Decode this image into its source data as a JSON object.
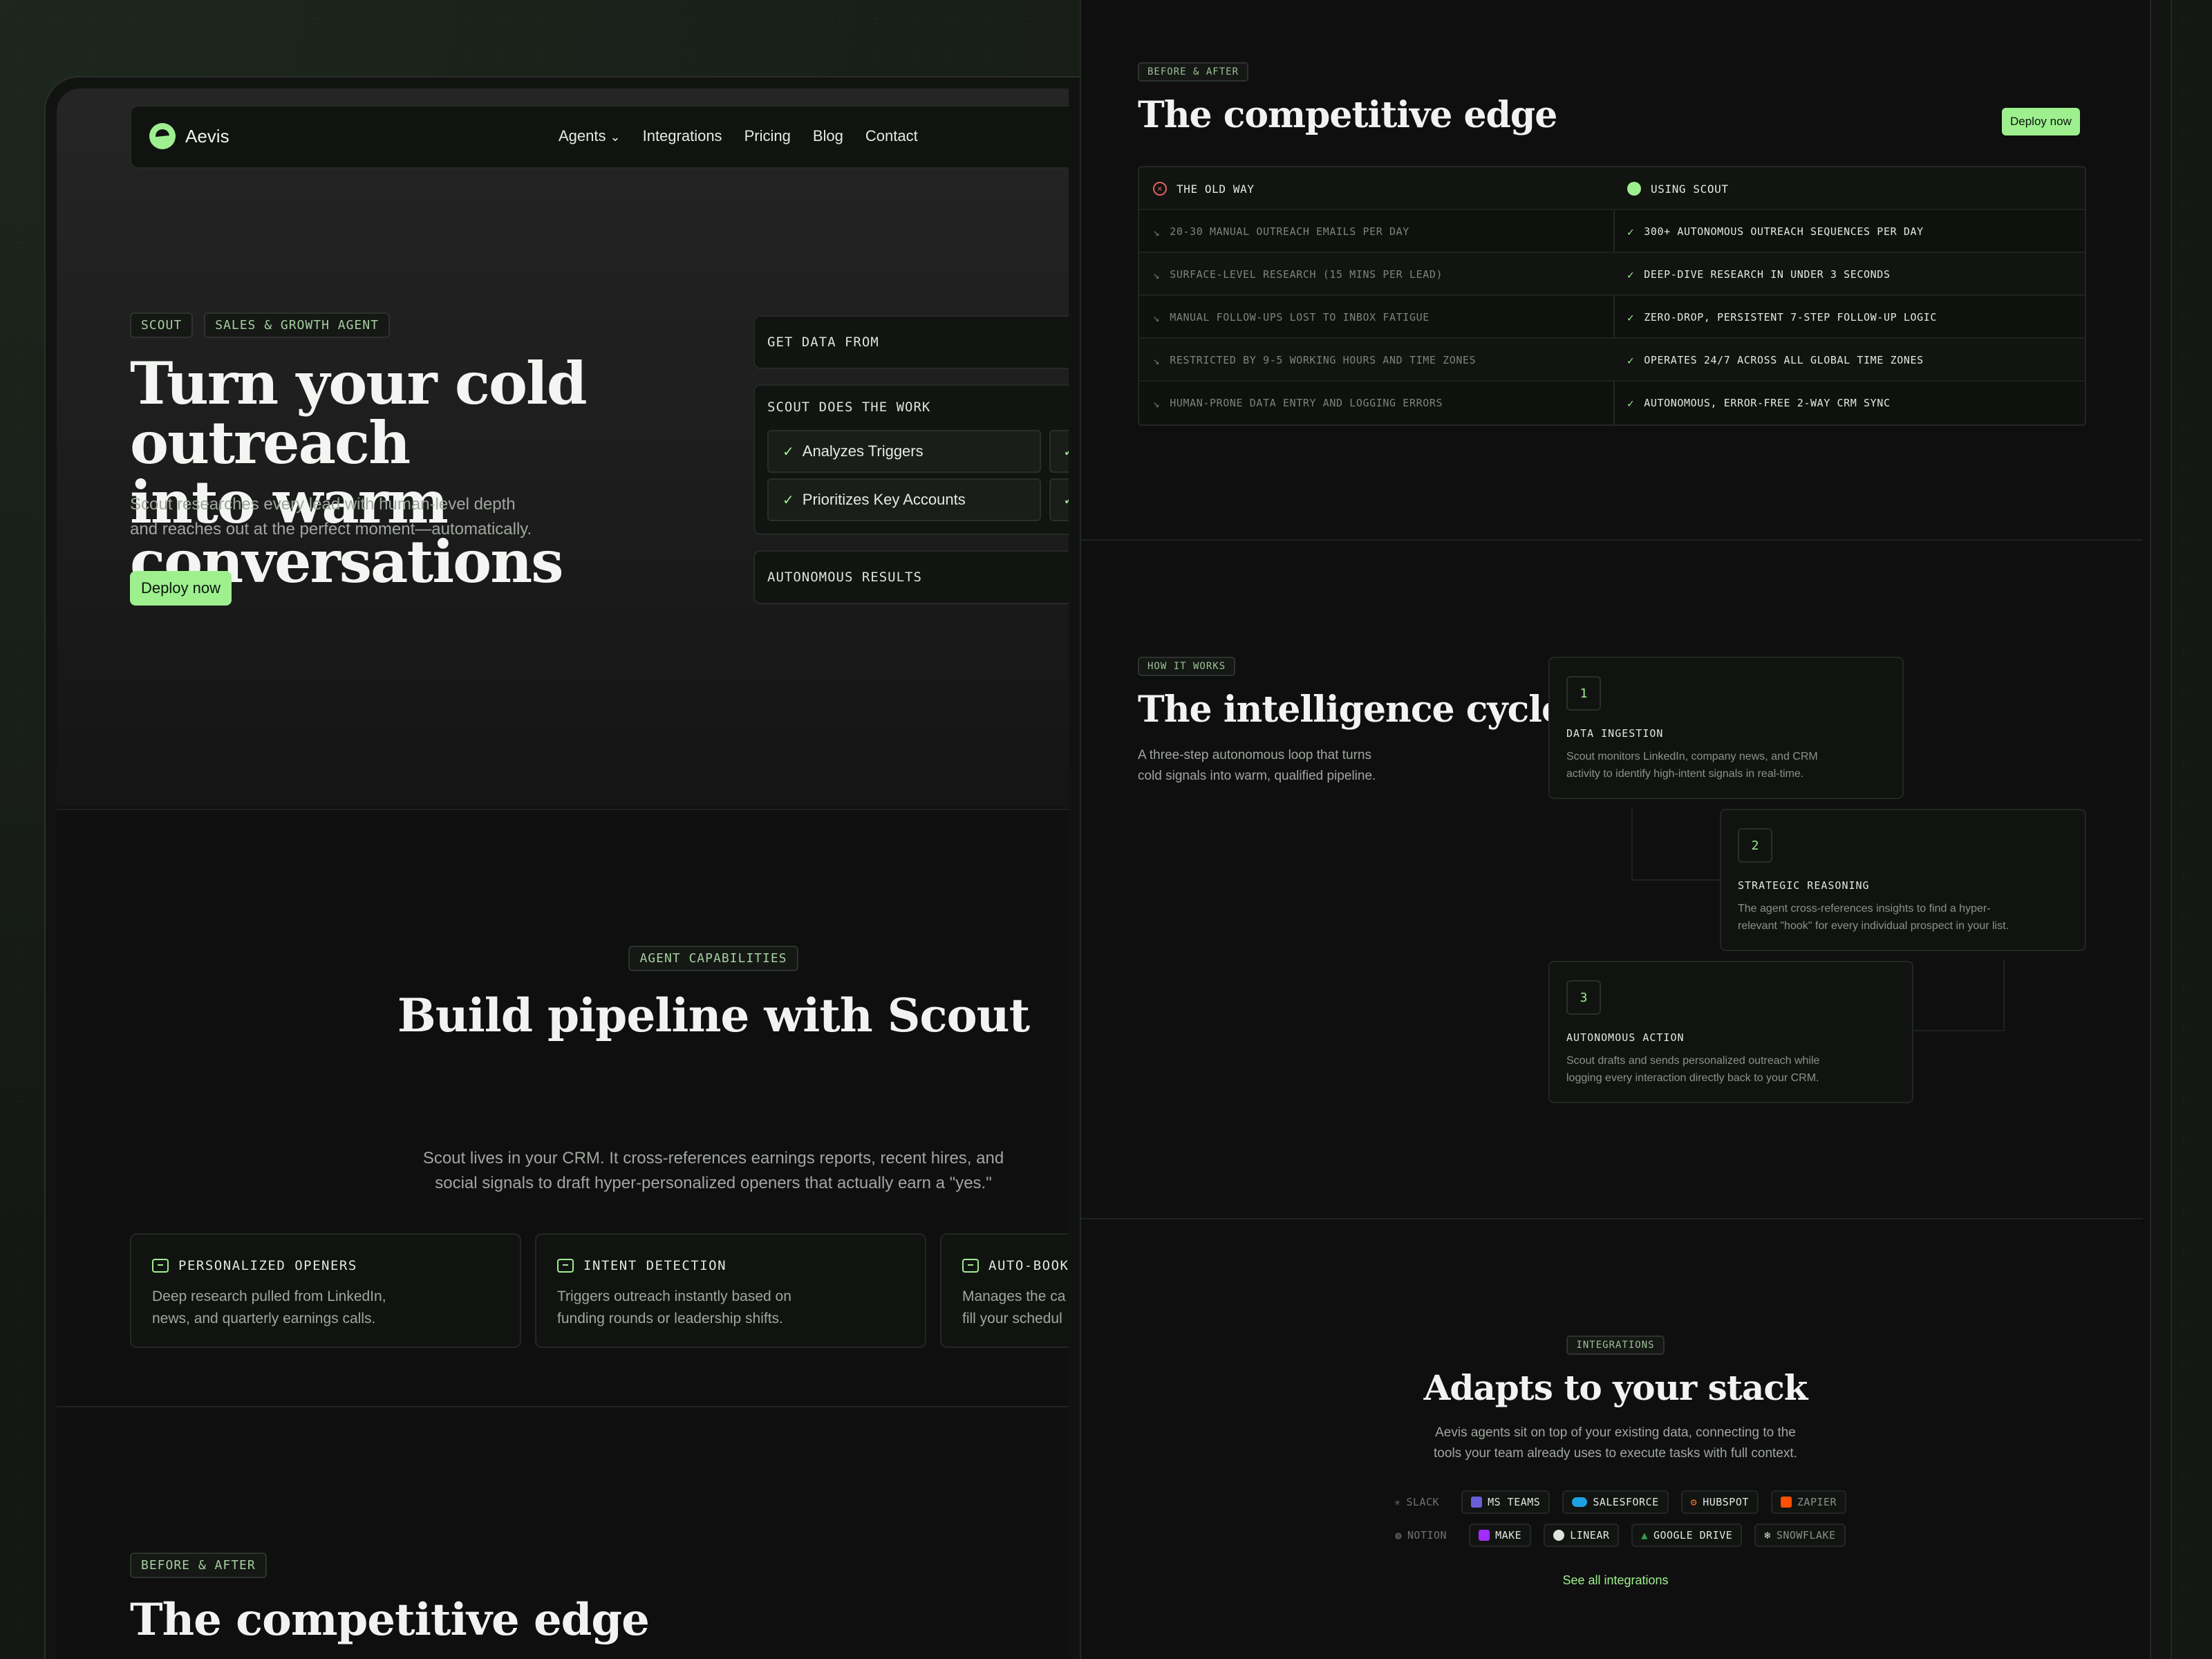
{
  "nav": {
    "brand": "Aevis",
    "links": [
      "Agents",
      "Integrations",
      "Pricing",
      "Blog",
      "Contact"
    ]
  },
  "hero": {
    "tags": [
      "SCOUT",
      "SALES & GROWTH AGENT"
    ],
    "title_line1": "Turn your cold outreach",
    "title_line2": "into warm conversations",
    "subtitle_line1": "Scout researches every lead with human-level depth",
    "subtitle_line2": "and reaches out at the perfect moment—automatically.",
    "cta": "Deploy now"
  },
  "workflow": {
    "get_data": "GET DATA FROM",
    "scout_work": "SCOUT DOES THE WORK",
    "items": [
      "Analyzes Triggers",
      "Prioritizes Key Accounts"
    ],
    "results": "AUTONOMOUS RESULTS"
  },
  "capabilities": {
    "tag": "AGENT CAPABILITIES",
    "title": "Build pipeline with Scout",
    "subtitle_line1": "Scout lives in your CRM. It cross-references earnings reports, recent hires, and",
    "subtitle_line2": "social signals to draft hyper-personalized openers that actually earn a \"yes.\"",
    "cards": [
      {
        "title": "PERSONALIZED OPENERS",
        "text_line1": "Deep research pulled from LinkedIn,",
        "text_line2": "news, and quarterly earnings calls."
      },
      {
        "title": "INTENT DETECTION",
        "text_line1": "Triggers outreach instantly based on",
        "text_line2": "funding rounds or leadership shifts."
      },
      {
        "title": "AUTO-BOOKI",
        "text_line1": "Manages the ca",
        "text_line2": "fill your schedul"
      }
    ]
  },
  "left_competitive": {
    "tag": "BEFORE & AFTER",
    "title": "The competitive edge"
  },
  "competitive": {
    "tag": "BEFORE & AFTER",
    "title": "The competitive edge",
    "cta": "Deploy now",
    "old_header": "THE OLD WAY",
    "new_header": "USING SCOUT",
    "old": [
      "20-30 MANUAL OUTREACH EMAILS PER DAY",
      "SURFACE-LEVEL RESEARCH (15 MINS PER LEAD)",
      "MANUAL FOLLOW-UPS LOST TO INBOX FATIGUE",
      "RESTRICTED BY 9-5 WORKING HOURS AND TIME ZONES",
      "HUMAN-PRONE DATA ENTRY AND LOGGING ERRORS"
    ],
    "new": [
      "300+ AUTONOMOUS OUTREACH SEQUENCES PER DAY",
      "DEEP-DIVE RESEARCH IN UNDER 3 SECONDS",
      "ZERO-DROP, PERSISTENT 7-STEP FOLLOW-UP LOGIC",
      "OPERATES 24/7 ACROSS ALL GLOBAL TIME ZONES",
      "AUTONOMOUS, ERROR-FREE 2-WAY CRM SYNC"
    ]
  },
  "cycle": {
    "tag": "HOW IT WORKS",
    "title": "The intelligence cycle",
    "subtitle_line1": "A three-step autonomous loop that turns",
    "subtitle_line2": "cold signals into warm, qualified pipeline.",
    "steps": [
      {
        "num": "1",
        "title": "DATA INGESTION",
        "text_line1": "Scout monitors LinkedIn, company news, and CRM",
        "text_line2": "activity to identify high-intent signals in real-time."
      },
      {
        "num": "2",
        "title": "STRATEGIC REASONING",
        "text_line1": "The agent cross-references insights to find a hyper-",
        "text_line2": "relevant \"hook\" for every individual prospect in your list."
      },
      {
        "num": "3",
        "title": "AUTONOMOUS ACTION",
        "text_line1": "Scout drafts and sends personalized outreach while",
        "text_line2": "logging every interaction directly back to your CRM."
      }
    ]
  },
  "integrations": {
    "tag": "INTEGRATIONS",
    "title": "Adapts to your stack",
    "subtitle_line1": "Aevis agents sit on top of your existing data, connecting to the",
    "subtitle_line2": "tools your team already uses to execute tasks with full context.",
    "row1": [
      "SLACK",
      "MS TEAMS",
      "SALESFORCE",
      "HUBSPOT",
      "ZAPIER"
    ],
    "row2": [
      "NOTION",
      "MAKE",
      "LINEAR",
      "GOOGLE DRIVE",
      "SNOWFLAKE"
    ],
    "see_all": "See all integrations",
    "colors": {
      "accent": "#9ef08f",
      "ms_teams": "#6b5fd6",
      "salesforce": "#1ea1e2",
      "hubspot": "#ff6a2b",
      "zapier": "#ff4f00",
      "make": "#a32cff",
      "google_drive": "#2ea44f"
    }
  }
}
